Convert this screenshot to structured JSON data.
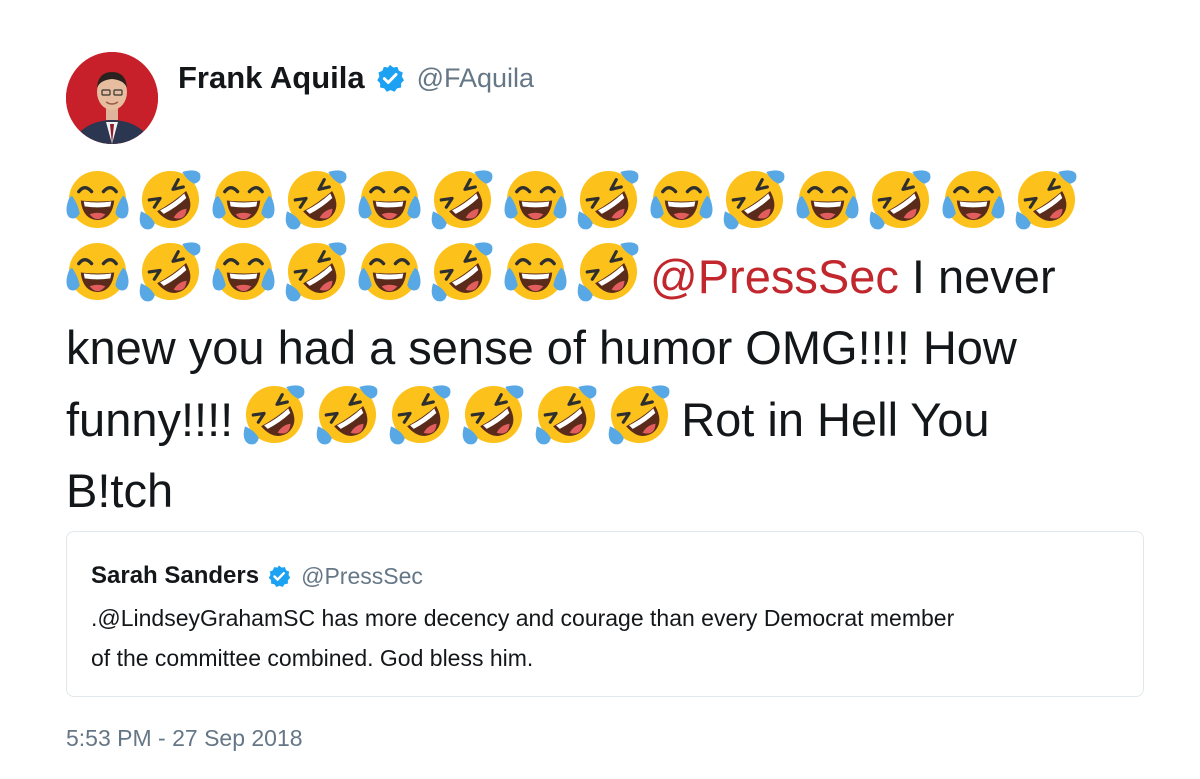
{
  "tweet": {
    "author": {
      "name": "Frank Aquila",
      "handle": "@FAquila",
      "verified": true
    },
    "body": {
      "emoji_row_1": [
        "joy",
        "rofl",
        "joy",
        "rofl",
        "joy",
        "rofl",
        "joy",
        "rofl",
        "joy",
        "rofl",
        "joy",
        "rofl",
        "joy",
        "rofl"
      ],
      "emoji_row_2": [
        "joy",
        "rofl",
        "joy",
        "rofl",
        "joy",
        "rofl",
        "joy",
        "rofl"
      ],
      "mention": "@PressSec",
      "text_1": "I never",
      "text_2": "knew you had a sense of humor OMG!!!! How",
      "text_3": "funny!!!!",
      "emoji_row_3": [
        "rofl",
        "rofl",
        "rofl",
        "rofl",
        "rofl",
        "rofl"
      ],
      "text_4": "Rot in Hell You",
      "text_5": "B!tch"
    },
    "quoted_tweet": {
      "author_name": "Sarah Sanders",
      "handle": "@PressSec",
      "verified": true,
      "text_line_1": ".@LindseyGrahamSC has more decency and courage than every Democrat member",
      "text_line_2": "of the committee combined. God bless him."
    },
    "timestamp": "5:53 PM - 27 Sep 2018"
  },
  "colors": {
    "mention": "#c1272d",
    "verified_badge": "#1da1f2",
    "secondary_text": "#657786",
    "border": "#e1e8ed",
    "avatar_background": "#c8202a"
  },
  "icons": {
    "verified": "verified-badge-icon",
    "emoji_joy": "face-with-tears-of-joy-icon",
    "emoji_rofl": "rolling-on-floor-laughing-icon"
  }
}
